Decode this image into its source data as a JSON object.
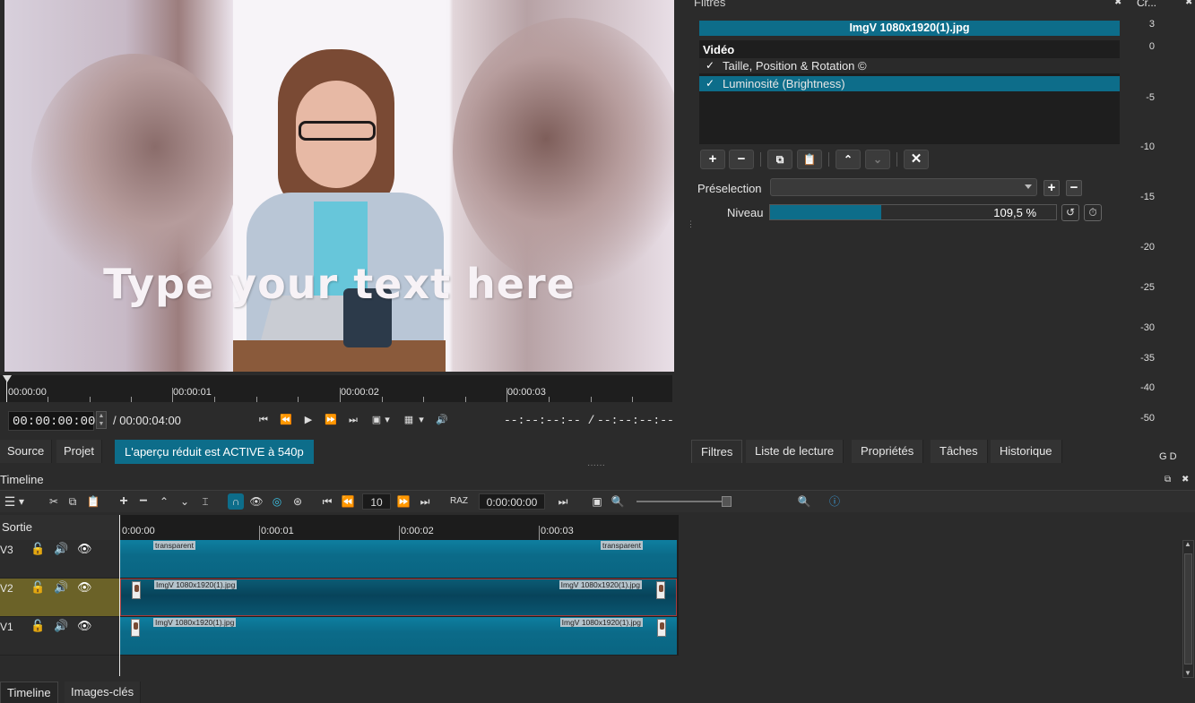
{
  "preview": {
    "overlay_text": "Type your text here"
  },
  "ruler": {
    "labels": [
      "00:00:00",
      "00:00:01",
      "00:00:02",
      "00:00:03"
    ]
  },
  "transport": {
    "current_timecode": "00:00:00:00",
    "duration": "/ 00:00:04:00",
    "in_point": "--:--:--:-- /",
    "out_point": "--:--:--:--"
  },
  "source_tabs": {
    "source": "Source",
    "projet": "Projet",
    "notice": "L'aperçu réduit est ACTIVE à 540p"
  },
  "filters": {
    "panel_title": "Filtres",
    "clip_name": "ImgV 1080x1920(1).jpg",
    "category": "Vidéo",
    "items": [
      {
        "label": "Taille, Position & Rotation ©",
        "checked": "✓",
        "selected": false
      },
      {
        "label": "Luminosité (Brightness)",
        "checked": "✓",
        "selected": true
      }
    ],
    "preset_label": "Préselection",
    "preset_value": "",
    "niveau_label": "Niveau",
    "niveau_value": "109,5 %",
    "niveau_fraction": 0.39
  },
  "meter": {
    "header": "Cr...",
    "labels": [
      "3",
      "0",
      "-5",
      "-10",
      "-15",
      "-20",
      "-25",
      "-30",
      "-35",
      "-40",
      "-50"
    ],
    "channels": "G D"
  },
  "right_tabs": [
    "Filtres",
    "Liste de lecture",
    "Propriétés",
    "Tâches",
    "Historique"
  ],
  "timeline": {
    "title": "Timeline",
    "ripple_value": "10",
    "raz_label": "RAZ",
    "timecode": "0:00:00:00",
    "header_label": "Sortie",
    "ruler_labels": [
      "0:00:00",
      "0:00:01",
      "0:00:02",
      "0:00:03"
    ],
    "tracks": [
      {
        "name": "V3",
        "clip_left": "transparent",
        "clip_right": "transparent"
      },
      {
        "name": "V2",
        "clip_left": "ImgV 1080x1920(1).jpg",
        "clip_right": "ImgV 1080x1920(1).jpg"
      },
      {
        "name": "V1",
        "clip_left": "ImgV 1080x1920(1).jpg",
        "clip_right": "ImgV 1080x1920(1).jpg"
      }
    ]
  },
  "bottom_tabs": [
    "Timeline",
    "Images-clés"
  ],
  "colors": {
    "accent": "#0d6d8a",
    "selected_track": "#6b6228",
    "clip": "#0b6b89"
  }
}
